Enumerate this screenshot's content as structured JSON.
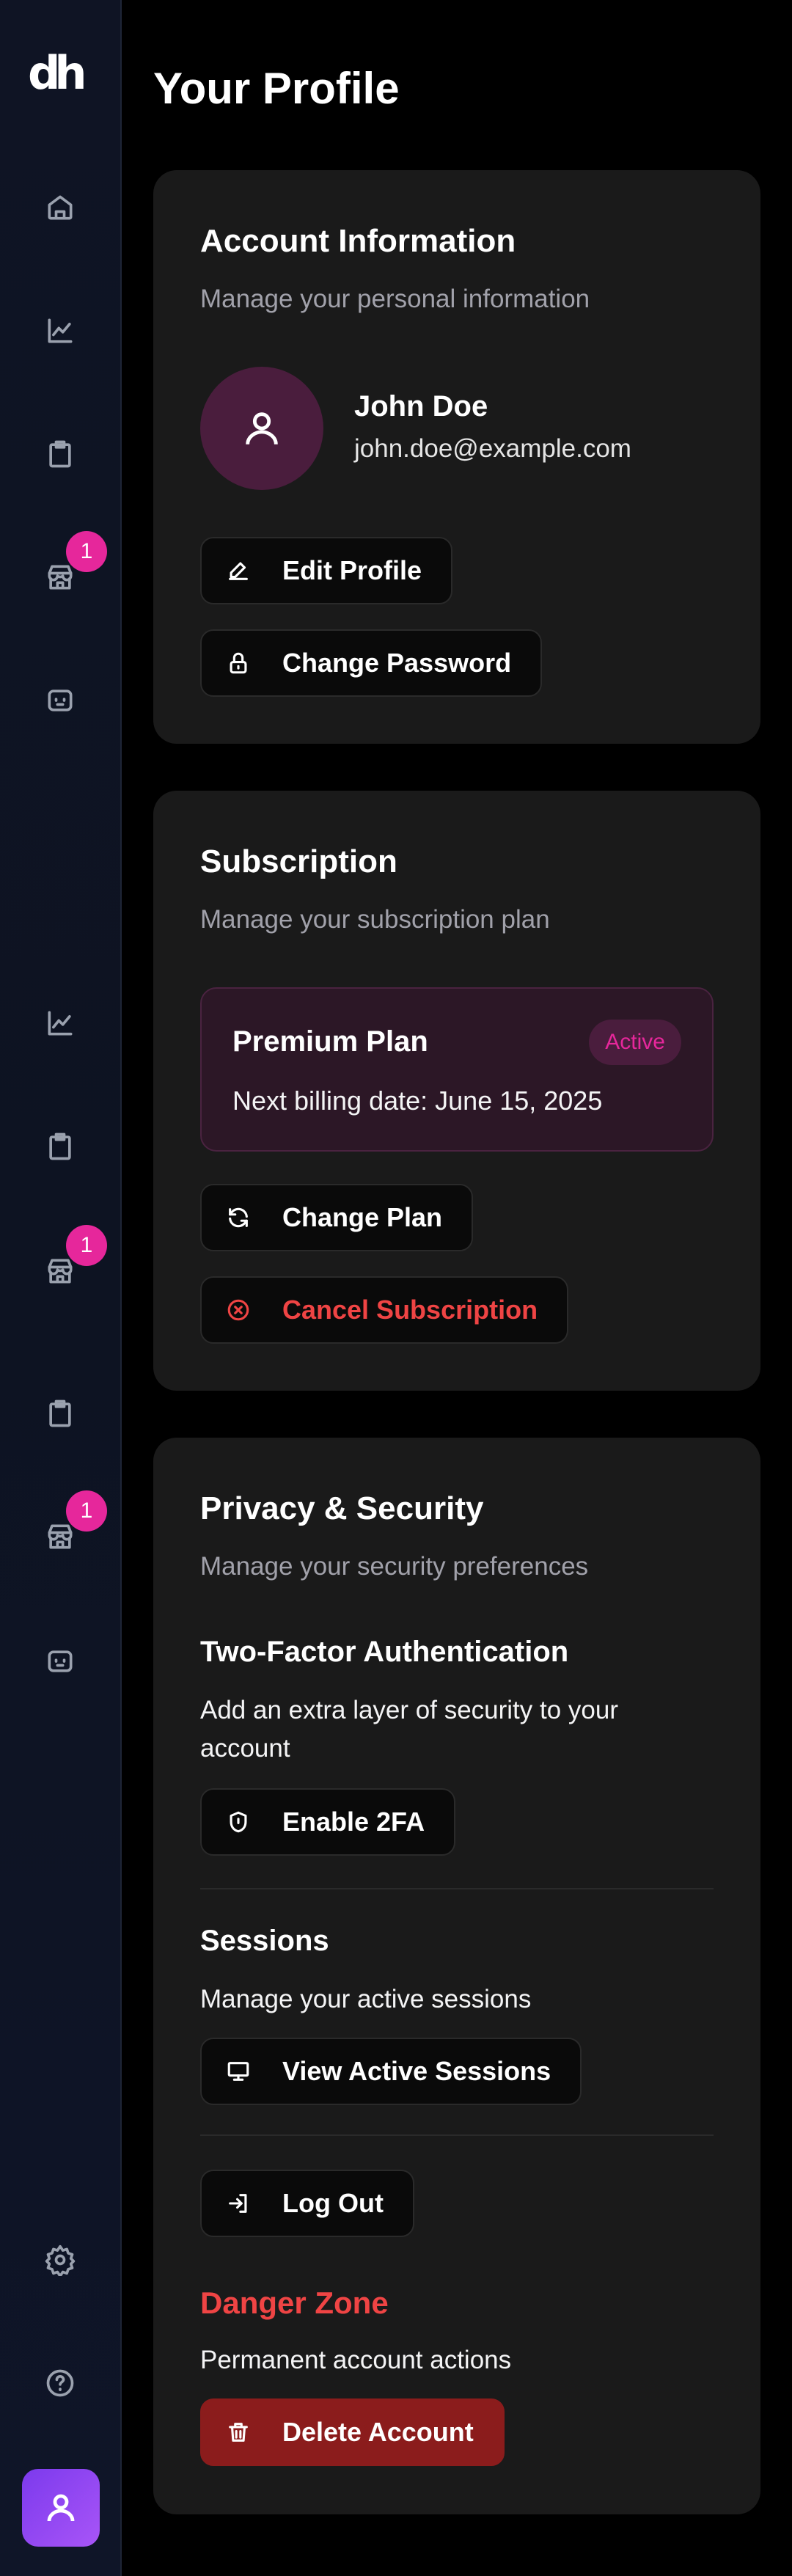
{
  "app": {
    "logo_text": "dh"
  },
  "sidebar": {
    "badges": [
      "1",
      "1",
      "1"
    ]
  },
  "page": {
    "title": "Your Profile"
  },
  "account": {
    "title": "Account Information",
    "subtitle": "Manage your personal information",
    "name": "John Doe",
    "email": "john.doe@example.com",
    "edit_label": "Edit Profile",
    "password_label": "Change Password"
  },
  "subscription": {
    "title": "Subscription",
    "subtitle": "Manage your subscription plan",
    "plan_name": "Premium Plan",
    "plan_status": "Active",
    "billing": "Next billing date: June 15, 2025",
    "change_label": "Change Plan",
    "cancel_label": "Cancel Subscription"
  },
  "privacy": {
    "title": "Privacy & Security",
    "subtitle": "Manage your security preferences",
    "twofa_title": "Two-Factor Authentication",
    "twofa_text": "Add an extra layer of security to your account",
    "twofa_button": "Enable 2FA",
    "sessions_title": "Sessions",
    "sessions_text": "Manage your active sessions",
    "sessions_button": "View Active Sessions",
    "logout_button": "Log Out",
    "danger_title": "Danger Zone",
    "danger_text": "Permanent account actions",
    "delete_button": "Delete Account"
  },
  "colors": {
    "accent": "#e6279b",
    "danger": "#ef4444",
    "card_bg": "#1a1a1a",
    "sidebar_bg": "#0f1424"
  }
}
